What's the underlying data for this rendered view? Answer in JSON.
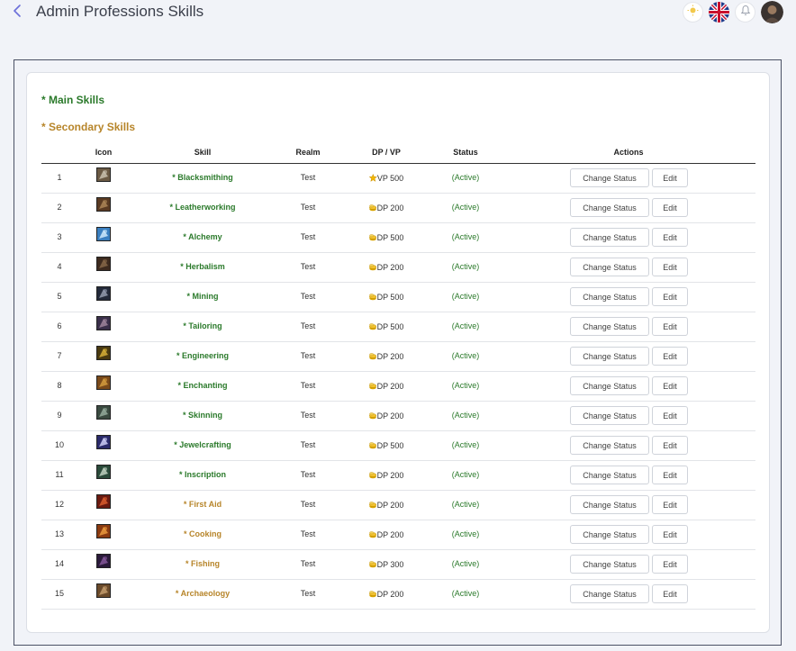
{
  "header": {
    "title": "Admin Professions Skills"
  },
  "sections": {
    "main_label": "* Main Skills",
    "secondary_label": "* Secondary Skills"
  },
  "columns": {
    "icon": "Icon",
    "skill": "Skill",
    "realm": "Realm",
    "dp_vp": "DP / VP",
    "status": "Status",
    "actions": "Actions"
  },
  "buttons": {
    "change_status": "Change Status",
    "edit": "Edit"
  },
  "rows": [
    {
      "num": "1",
      "skill": "* Blacksmithing",
      "type": "main",
      "realm": "Test",
      "cost": "VP 500",
      "cost_icon": "star",
      "status": "(Active)",
      "icon_colors": [
        "#6b5a44",
        "#cfc7b5"
      ]
    },
    {
      "num": "2",
      "skill": "* Leatherworking",
      "type": "main",
      "realm": "Test",
      "cost": "DP 200",
      "cost_icon": "coin",
      "status": "(Active)",
      "icon_colors": [
        "#5a3a22",
        "#b08a5a"
      ]
    },
    {
      "num": "3",
      "skill": "* Alchemy",
      "type": "main",
      "realm": "Test",
      "cost": "DP 500",
      "cost_icon": "coin",
      "status": "(Active)",
      "icon_colors": [
        "#3a7fc0",
        "#d8f0ff"
      ]
    },
    {
      "num": "4",
      "skill": "* Herbalism",
      "type": "main",
      "realm": "Test",
      "cost": "DP 200",
      "cost_icon": "coin",
      "status": "(Active)",
      "icon_colors": [
        "#3d2a1e",
        "#8a6a4a"
      ]
    },
    {
      "num": "5",
      "skill": "* Mining",
      "type": "main",
      "realm": "Test",
      "cost": "DP 500",
      "cost_icon": "coin",
      "status": "(Active)",
      "icon_colors": [
        "#232a3a",
        "#9aa2b5"
      ]
    },
    {
      "num": "6",
      "skill": "* Tailoring",
      "type": "main",
      "realm": "Test",
      "cost": "DP 500",
      "cost_icon": "coin",
      "status": "(Active)",
      "icon_colors": [
        "#3a2f4a",
        "#a58aa0"
      ]
    },
    {
      "num": "7",
      "skill": "* Engineering",
      "type": "main",
      "realm": "Test",
      "cost": "DP 200",
      "cost_icon": "coin",
      "status": "(Active)",
      "icon_colors": [
        "#4a3a10",
        "#e0b83a"
      ]
    },
    {
      "num": "8",
      "skill": "* Enchanting",
      "type": "main",
      "realm": "Test",
      "cost": "DP 200",
      "cost_icon": "coin",
      "status": "(Active)",
      "icon_colors": [
        "#7a4a1a",
        "#d9a040"
      ]
    },
    {
      "num": "9",
      "skill": "* Skinning",
      "type": "main",
      "realm": "Test",
      "cost": "DP 200",
      "cost_icon": "coin",
      "status": "(Active)",
      "icon_colors": [
        "#3a4a40",
        "#9ab0a0"
      ]
    },
    {
      "num": "10",
      "skill": "* Jewelcrafting",
      "type": "main",
      "realm": "Test",
      "cost": "DP 500",
      "cost_icon": "coin",
      "status": "(Active)",
      "icon_colors": [
        "#2a2a6a",
        "#d8d8ff"
      ]
    },
    {
      "num": "11",
      "skill": "* Inscription",
      "type": "main",
      "realm": "Test",
      "cost": "DP 200",
      "cost_icon": "coin",
      "status": "(Active)",
      "icon_colors": [
        "#2a4a3a",
        "#c8d8c8"
      ]
    },
    {
      "num": "12",
      "skill": "* First Aid",
      "type": "secondary",
      "realm": "Test",
      "cost": "DP 200",
      "cost_icon": "coin",
      "status": "(Active)",
      "icon_colors": [
        "#6a1a10",
        "#e06030"
      ]
    },
    {
      "num": "13",
      "skill": "* Cooking",
      "type": "secondary",
      "realm": "Test",
      "cost": "DP 200",
      "cost_icon": "coin",
      "status": "(Active)",
      "icon_colors": [
        "#8a3a10",
        "#f0a040"
      ]
    },
    {
      "num": "14",
      "skill": "* Fishing",
      "type": "secondary",
      "realm": "Test",
      "cost": "DP 300",
      "cost_icon": "coin",
      "status": "(Active)",
      "icon_colors": [
        "#2a1a3a",
        "#8a5aa0"
      ]
    },
    {
      "num": "15",
      "skill": "* Archaeology",
      "type": "secondary",
      "realm": "Test",
      "cost": "DP 200",
      "cost_icon": "coin",
      "status": "(Active)",
      "icon_colors": [
        "#6a4a2a",
        "#c8a070"
      ]
    }
  ],
  "colors": {
    "main_skill": "#2b7a2b",
    "secondary_skill": "#b7852a",
    "accent": "#6b6fd9"
  }
}
